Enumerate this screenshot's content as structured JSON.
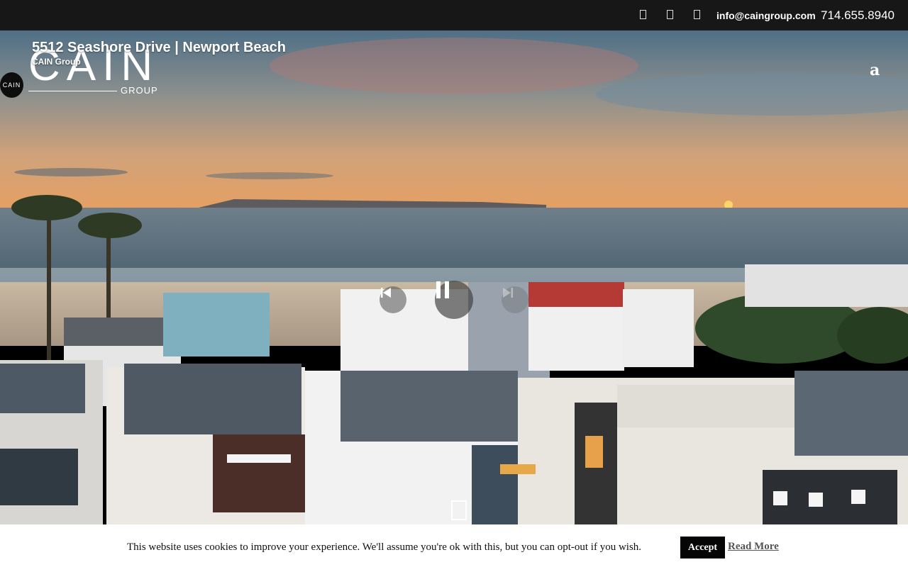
{
  "topbar": {
    "email": "info@caingroup.com",
    "phone": "714.655.8940",
    "icons": [
      "facebook-icon",
      "instagram-icon",
      "youtube-icon"
    ]
  },
  "video": {
    "title": "5512 Seashore Drive | Newport Beach",
    "channel": "CAIN Group",
    "avatar_text": "CAIN"
  },
  "logo": {
    "word": "CAIN",
    "sub": "GROUP"
  },
  "menu_toggle": "a",
  "cookie": {
    "message": "This website uses cookies to improve your experience. We'll assume you're ok with this, but you can opt-out if you wish.",
    "accept_label": "Accept",
    "read_more_label": "Read More"
  },
  "colors": {
    "topbar_bg": "#171717",
    "cookie_bg": "#ffffff",
    "accept_bg": "#050505"
  }
}
